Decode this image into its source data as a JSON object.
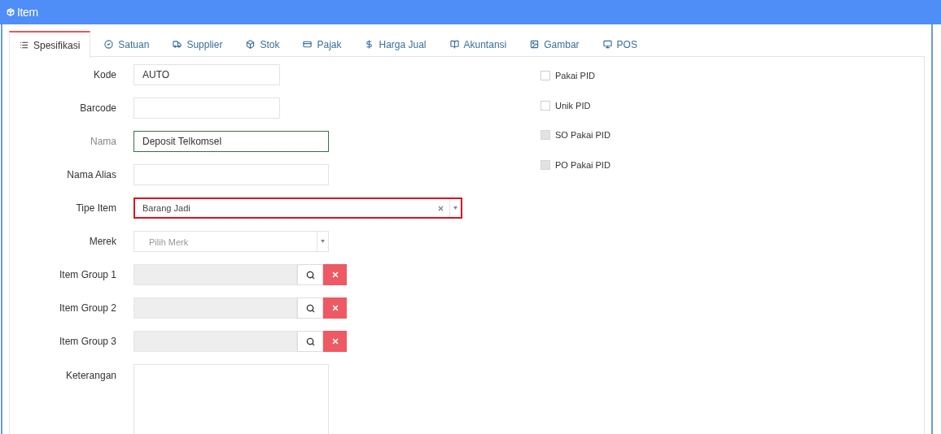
{
  "header": {
    "title": "Item"
  },
  "tabs": [
    {
      "label": "Spesifikasi",
      "selected": true
    },
    {
      "label": "Satuan",
      "selected": false
    },
    {
      "label": "Supplier",
      "selected": false
    },
    {
      "label": "Stok",
      "selected": false
    },
    {
      "label": "Pajak",
      "selected": false
    },
    {
      "label": "Harga Jual",
      "selected": false
    },
    {
      "label": "Akuntansi",
      "selected": false
    },
    {
      "label": "Gambar",
      "selected": false
    },
    {
      "label": "POS",
      "selected": false
    }
  ],
  "fields": [
    {
      "label": "Kode",
      "kind": "text",
      "value": "AUTO",
      "focused": false
    },
    {
      "label": "Barcode",
      "kind": "text",
      "focused": false
    },
    {
      "label": "Nama",
      "kind": "text",
      "value": "Deposit Telkomsel",
      "focused": true
    },
    {
      "label": "Nama Alias",
      "kind": "text",
      "focused": false
    },
    {
      "label": "Tipe Item",
      "kind": "select",
      "value": "Barang Jadi",
      "clearable": true,
      "highlighted": true
    },
    {
      "label": "Merek",
      "kind": "select",
      "placeholder": "Pilih Merk",
      "clearable": false,
      "highlighted": false
    },
    {
      "label": "Item Group 1",
      "kind": "lookup"
    },
    {
      "label": "Item Group 2",
      "kind": "lookup"
    },
    {
      "label": "Item Group 3",
      "kind": "lookup"
    },
    {
      "label": "Keterangan",
      "kind": "textarea"
    }
  ],
  "options": [
    {
      "label": "Pakai PID",
      "checked": false,
      "disabled": false
    },
    {
      "label": "Unik PID",
      "checked": false,
      "disabled": false
    },
    {
      "label": "SO Pakai PID",
      "checked": false,
      "disabled": true
    },
    {
      "label": "PO Pakai PID",
      "checked": false,
      "disabled": true
    }
  ]
}
